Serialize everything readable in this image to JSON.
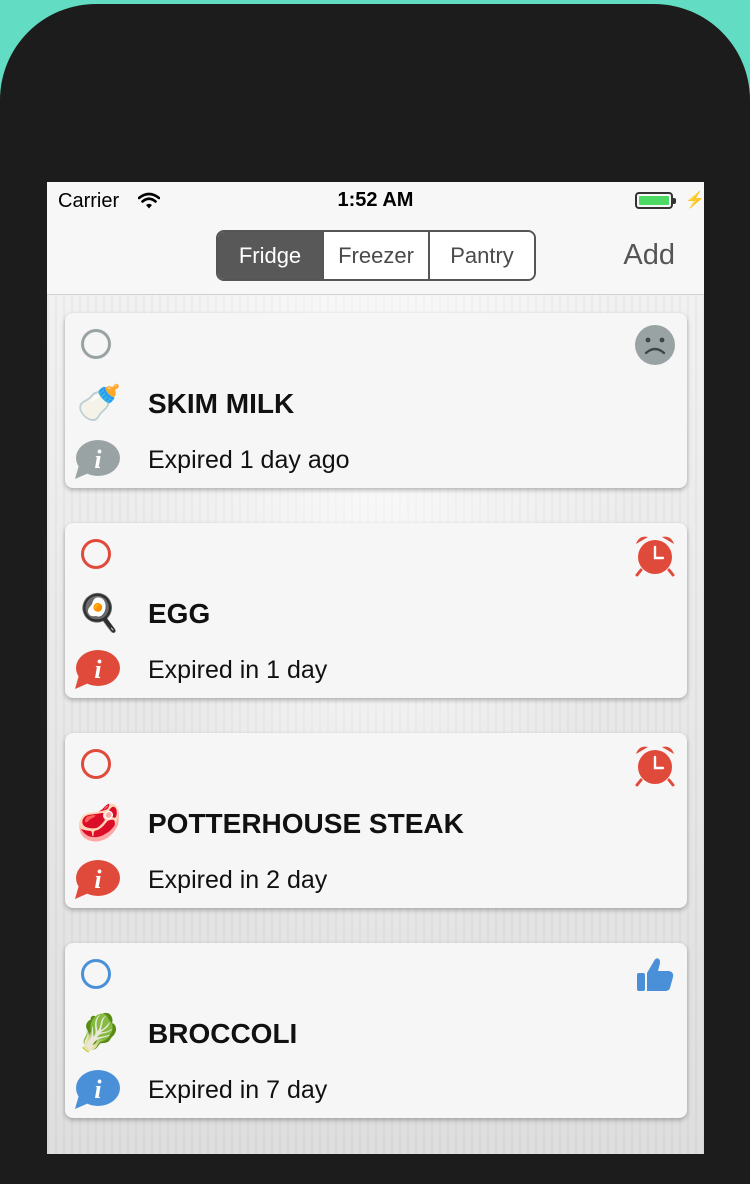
{
  "status_bar": {
    "carrier": "Carrier",
    "time": "1:52 AM",
    "battery_level_percent": 100,
    "charging": true
  },
  "nav": {
    "segments": [
      "Fridge",
      "Freezer",
      "Pantry"
    ],
    "selected_segment": "Fridge",
    "add_label": "Add"
  },
  "colors": {
    "gray": "#9aa3a3",
    "red": "#e04a3a",
    "blue": "#4a90d9"
  },
  "items": [
    {
      "name": "SKIM MILK",
      "expiry": "Expired 1 day ago",
      "food_icon": "baby-bottle-icon",
      "food_glyph": "🍼",
      "status": "expired",
      "status_icon": "sad-face-icon",
      "color": "#9aa3a3"
    },
    {
      "name": "EGG",
      "expiry": "Expired in 1 day",
      "food_icon": "fried-egg-icon",
      "food_glyph": "🍳",
      "status": "urgent",
      "status_icon": "alarm-clock-icon",
      "color": "#e04a3a"
    },
    {
      "name": "POTTERHOUSE STEAK",
      "expiry": "Expired in 2 day",
      "food_icon": "steak-icon",
      "food_glyph": "🥩",
      "status": "urgent",
      "status_icon": "alarm-clock-icon",
      "color": "#e04a3a"
    },
    {
      "name": "BROCCOLI",
      "expiry": "Expired in 7 day",
      "food_icon": "leafy-green-icon",
      "food_glyph": "🥬",
      "status": "fresh",
      "status_icon": "thumbs-up-icon",
      "color": "#4a90d9"
    }
  ]
}
